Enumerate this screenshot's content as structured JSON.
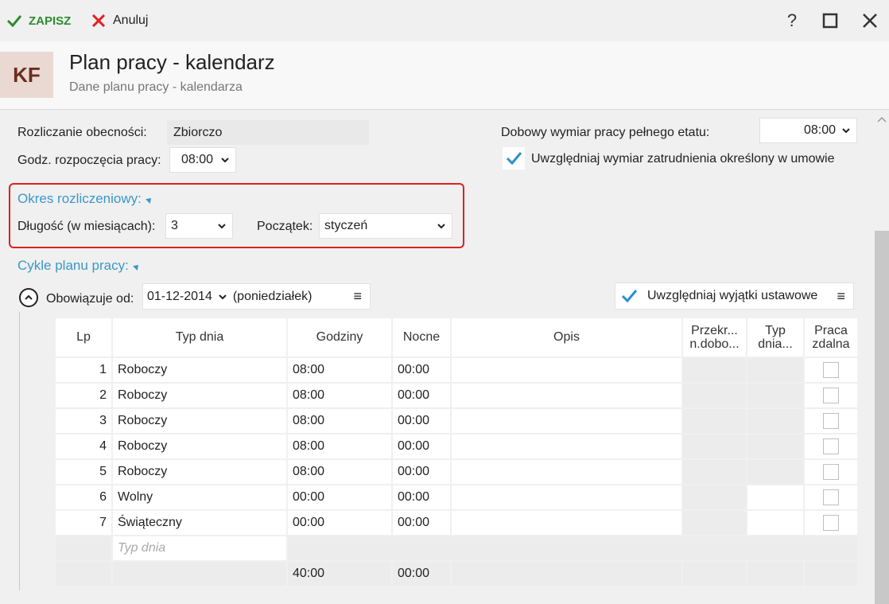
{
  "toolbar": {
    "save_label": "ZAPISZ",
    "cancel_label": "Anuluj",
    "help_label": "?"
  },
  "header": {
    "badge": "KF",
    "title": "Plan pracy - kalendarz",
    "subtitle": "Dane planu pracy - kalendarza"
  },
  "form": {
    "attendance_label": "Rozliczanie obecności:",
    "attendance_value": "Zbiorczo",
    "start_label": "Godz. rozpoczęcia pracy:",
    "start_value": "08:00",
    "daily_label": "Dobowy wymiar pracy pełnego etatu:",
    "daily_value": "08:00",
    "include_contract_label": "Uwzględniaj wymiar zatrudnienia określony w umowie",
    "include_contract_checked": true
  },
  "period": {
    "title": "Okres rozliczeniowy:",
    "length_label": "Długość (w miesiącach):",
    "length_value": "3",
    "start_label": "Początek:",
    "start_value": "styczeń"
  },
  "cycles": {
    "title": "Cykle planu pracy:",
    "valid_from_label": "Obowiązuje od:",
    "valid_from_value": "01-12-2014",
    "weekday": "(poniedziałek)",
    "exceptions_label": "Uwzględniaj wyjątki ustawowe",
    "exceptions_checked": true
  },
  "grid": {
    "columns": {
      "lp": "Lp",
      "type": "Typ dnia",
      "hours": "Godziny",
      "night": "Nocne",
      "desc": "Opis",
      "overrun_1": "Przekr...",
      "overrun_2": "n.dobo...",
      "daytype_1": "Typ",
      "daytype_2": "dnia...",
      "remote_1": "Praca",
      "remote_2": "zdalna"
    },
    "rows": [
      {
        "lp": "1",
        "type": "Roboczy",
        "hours": "08:00",
        "night": "00:00",
        "desc": ""
      },
      {
        "lp": "2",
        "type": "Roboczy",
        "hours": "08:00",
        "night": "00:00",
        "desc": ""
      },
      {
        "lp": "3",
        "type": "Roboczy",
        "hours": "08:00",
        "night": "00:00",
        "desc": ""
      },
      {
        "lp": "4",
        "type": "Roboczy",
        "hours": "08:00",
        "night": "00:00",
        "desc": ""
      },
      {
        "lp": "5",
        "type": "Roboczy",
        "hours": "08:00",
        "night": "00:00",
        "desc": ""
      },
      {
        "lp": "6",
        "type": "Wolny",
        "hours": "00:00",
        "night": "00:00",
        "desc": ""
      },
      {
        "lp": "7",
        "type": "Świąteczny",
        "hours": "00:00",
        "night": "00:00",
        "desc": ""
      }
    ],
    "new_row_placeholder": "Typ dnia",
    "totals": {
      "hours": "40:00",
      "night": "00:00"
    }
  },
  "colors": {
    "accent_blue": "#3a98c8",
    "save_green": "#2e8b2e",
    "cancel_red": "#e02020",
    "highlight_red": "#e02020",
    "badge_bg": "#ead9d2",
    "badge_fg": "#6b2e1f"
  }
}
